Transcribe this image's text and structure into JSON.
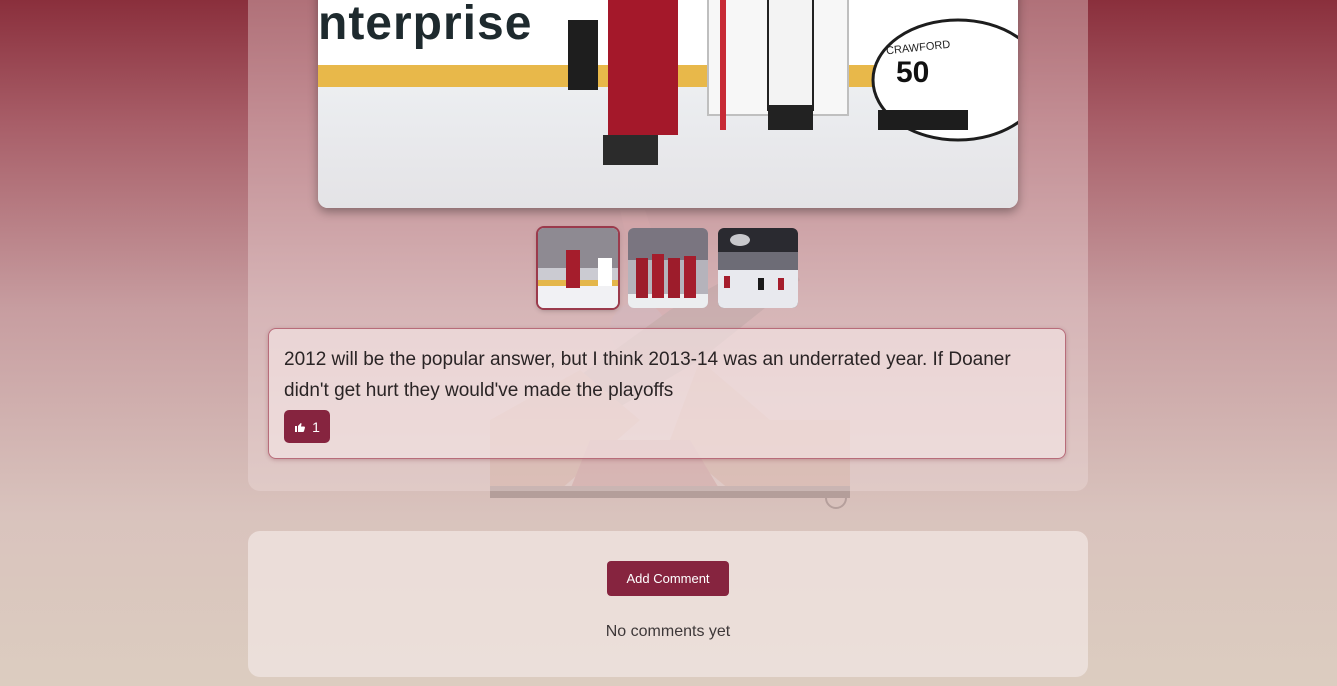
{
  "gallery": {
    "main_image_alt": "Coyotes player celebrating in front of the net",
    "main_board_text": "nterprise",
    "main_jersey_name": "CRAWFORD",
    "main_jersey_number": "50",
    "thumbnails": [
      {
        "alt": "Player celebrating goal",
        "active": true
      },
      {
        "alt": "Team celebrating on ice",
        "active": false
      },
      {
        "alt": "Arena view of game",
        "active": false
      }
    ]
  },
  "post": {
    "text": "2012 will be the popular answer, but I think 2013-14 was an underrated year. If Doaner didn't get hurt they would've made the playoffs",
    "like_count": "1",
    "like_icon": "thumbs-up-icon"
  },
  "comments": {
    "add_label": "Add Comment",
    "empty_text": "No comments yet"
  },
  "colors": {
    "accent": "#86243f",
    "background_top": "#8a2f3c",
    "background_bottom": "#dccdc0"
  }
}
